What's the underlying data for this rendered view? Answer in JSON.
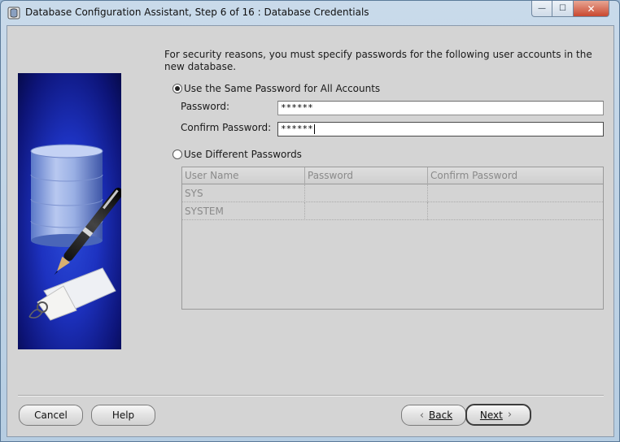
{
  "window": {
    "title": "Database Configuration Assistant, Step 6 of 16 : Database Credentials",
    "controls": {
      "minimize": "—",
      "maximize": "☐",
      "close": "✕"
    }
  },
  "intro_text": "For security reasons, you must specify passwords for the following user accounts in the new database.",
  "same_password": {
    "label": "Use the Same Password for All Accounts",
    "selected": true,
    "password_label": "Password:",
    "password_value": "******",
    "confirm_label": "Confirm Password:",
    "confirm_value": "******"
  },
  "different_passwords": {
    "label": "Use Different Passwords",
    "selected": false,
    "columns": [
      "User Name",
      "Password",
      "Confirm Password"
    ],
    "rows": [
      {
        "user": "SYS",
        "password": "",
        "confirm": ""
      },
      {
        "user": "SYSTEM",
        "password": "",
        "confirm": ""
      }
    ]
  },
  "buttons": {
    "cancel": "Cancel",
    "help": "Help",
    "back": "Back",
    "next": "Next"
  },
  "icons": {
    "app": "database-assistant-icon",
    "back": "chevron-left-icon",
    "next": "chevron-right-icon"
  }
}
